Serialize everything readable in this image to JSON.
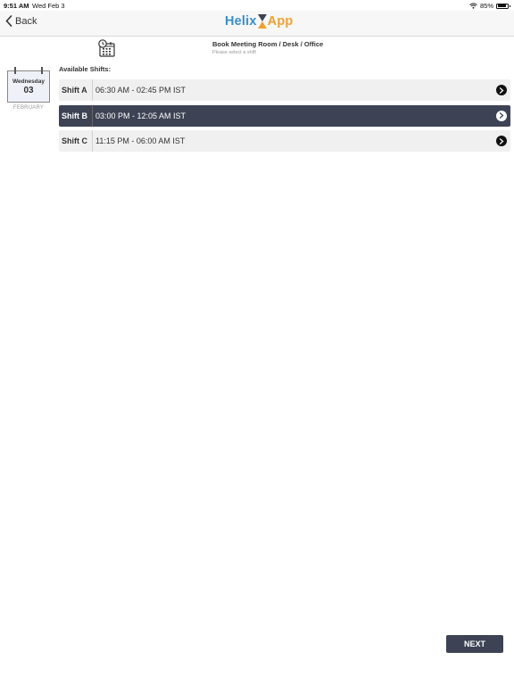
{
  "status_bar": {
    "time": "9:51 AM",
    "date": "Wed Feb 3",
    "battery": "85%",
    "battery_level": 0.85
  },
  "nav": {
    "back_label": "Back",
    "logo_part1": "Helix",
    "logo_part2": "App"
  },
  "header": {
    "title": "Book Meeting Room / Desk / Office",
    "subtitle": "Please select a shift"
  },
  "calendar": {
    "weekday": "Wednesday",
    "day": "03",
    "month": "FEBRUARY"
  },
  "available_label": "Available Shifts:",
  "shifts": [
    {
      "name": "Shift A",
      "time": "06:30 AM - 02:45 PM IST",
      "selected": false
    },
    {
      "name": "Shift B",
      "time": "03:00 PM - 12:05 AM IST",
      "selected": true
    },
    {
      "name": "Shift C",
      "time": "11:15 PM - 06:00 AM IST",
      "selected": false
    }
  ],
  "next_label": "NEXT",
  "colors": {
    "accent_dark": "#3d4354",
    "logo_blue": "#3a8fc7",
    "logo_orange": "#f0a030"
  },
  "icons": {
    "back": "chevron-left-icon",
    "page": "calendar-clock-icon",
    "wifi": "wifi-icon",
    "battery": "battery-icon",
    "shift_arrow": "chevron-right-circle-icon",
    "logo_mark": "hourglass-icon"
  }
}
